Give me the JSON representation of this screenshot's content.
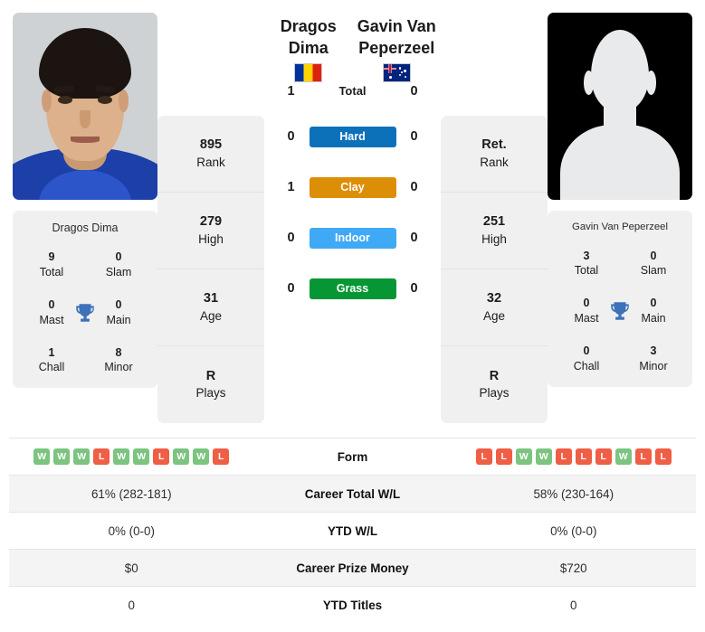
{
  "players": {
    "left": {
      "name": "Dragos Dima",
      "photo_type": "headshot",
      "flag": "romania-flag",
      "stats": [
        {
          "value": "895",
          "label": "Rank"
        },
        {
          "value": "279",
          "label": "High"
        },
        {
          "value": "31",
          "label": "Age"
        },
        {
          "value": "R",
          "label": "Plays"
        }
      ],
      "titles_name": "Dragos Dima",
      "titles": [
        {
          "value": "9",
          "label": "Total"
        },
        {
          "value": "0",
          "label": "Slam"
        },
        {
          "value": "0",
          "label": "Mast"
        },
        {
          "value": "0",
          "label": "Main"
        },
        {
          "value": "1",
          "label": "Chall"
        },
        {
          "value": "8",
          "label": "Minor"
        }
      ],
      "form": [
        "W",
        "W",
        "W",
        "L",
        "W",
        "W",
        "L",
        "W",
        "W",
        "L"
      ],
      "career_wl": "61% (282-181)",
      "ytd_wl": "0% (0-0)",
      "career_prize": "$0",
      "ytd_titles": "0"
    },
    "right": {
      "name": "Gavin Van Peperzeel",
      "name_line1": "Gavin Van",
      "name_line2": "Peperzeel",
      "photo_type": "silhouette-placeholder",
      "flag": "australia-flag",
      "stats": [
        {
          "value": "Ret.",
          "label": "Rank"
        },
        {
          "value": "251",
          "label": "High"
        },
        {
          "value": "32",
          "label": "Age"
        },
        {
          "value": "R",
          "label": "Plays"
        }
      ],
      "titles_name": "Gavin Van Peperzeel",
      "titles": [
        {
          "value": "3",
          "label": "Total"
        },
        {
          "value": "0",
          "label": "Slam"
        },
        {
          "value": "0",
          "label": "Mast"
        },
        {
          "value": "0",
          "label": "Main"
        },
        {
          "value": "0",
          "label": "Chall"
        },
        {
          "value": "3",
          "label": "Minor"
        }
      ],
      "form": [
        "L",
        "L",
        "W",
        "W",
        "L",
        "L",
        "L",
        "W",
        "L",
        "L"
      ],
      "career_wl": "58% (230-164)",
      "ytd_wl": "0% (0-0)",
      "career_prize": "$720",
      "ytd_titles": "0"
    }
  },
  "h2h": {
    "total": {
      "label": "Total",
      "left": "1",
      "right": "0"
    },
    "surfaces": [
      {
        "label": "Hard",
        "left": "0",
        "right": "0",
        "color": "#0d71ba"
      },
      {
        "label": "Clay",
        "left": "1",
        "right": "0",
        "color": "#dd8e07"
      },
      {
        "label": "Indoor",
        "left": "0",
        "right": "0",
        "color": "#3fa9f5"
      },
      {
        "label": "Grass",
        "left": "0",
        "right": "0",
        "color": "#069734"
      }
    ]
  },
  "table": {
    "rows": [
      {
        "label": "Form",
        "type": "form"
      },
      {
        "label": "Career Total W/L",
        "type": "text",
        "left": "61% (282-181)",
        "right": "58% (230-164)"
      },
      {
        "label": "YTD W/L",
        "type": "text",
        "left": "0% (0-0)",
        "right": "0% (0-0)"
      },
      {
        "label": "Career Prize Money",
        "type": "text",
        "left": "$0",
        "right": "$720"
      },
      {
        "label": "YTD Titles",
        "type": "text",
        "left": "0",
        "right": "0"
      }
    ]
  },
  "colors": {
    "win_badge": "#7cc47f",
    "loss_badge": "#ef5e45",
    "card_bg": "#f0f0f0",
    "trophy": "#3d72b8"
  }
}
